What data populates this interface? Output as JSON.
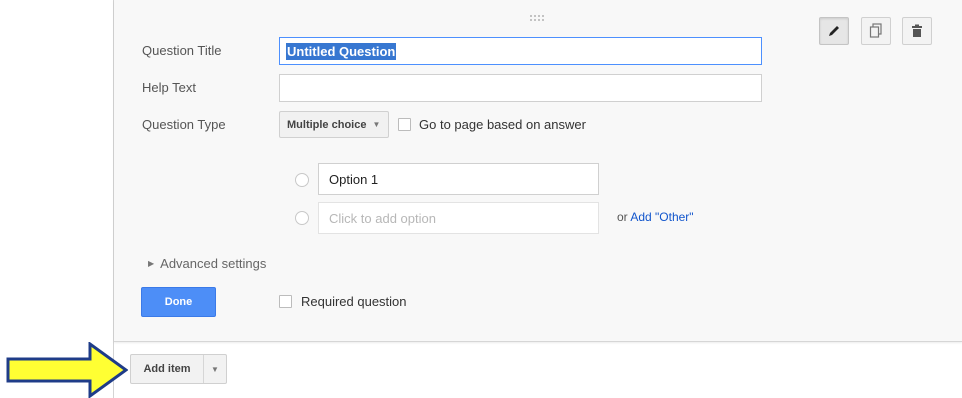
{
  "question": {
    "title_label": "Question Title",
    "title_value": "Untitled Question",
    "help_label": "Help Text",
    "help_value": "",
    "type_label": "Question Type",
    "type_value": "Multiple choice",
    "go_to_page_label": "Go to page based on answer"
  },
  "options": {
    "option1": "Option 1",
    "add_placeholder": "Click to add option",
    "or_text": "or",
    "add_other": "Add \"Other\""
  },
  "advanced_label": "Advanced settings",
  "done_label": "Done",
  "required_label": "Required question",
  "add_item_label": "Add item",
  "icons": [
    "drag-handle-icon",
    "pencil-icon",
    "duplicate-icon",
    "trash-icon",
    "chevron-down-icon",
    "arrow-icon"
  ],
  "colors": {
    "accent": "#4d8ef7",
    "link": "#1155cc",
    "selection": "#3777d1",
    "arrow_fill": "#ffff33",
    "arrow_stroke": "#1f3c88"
  }
}
